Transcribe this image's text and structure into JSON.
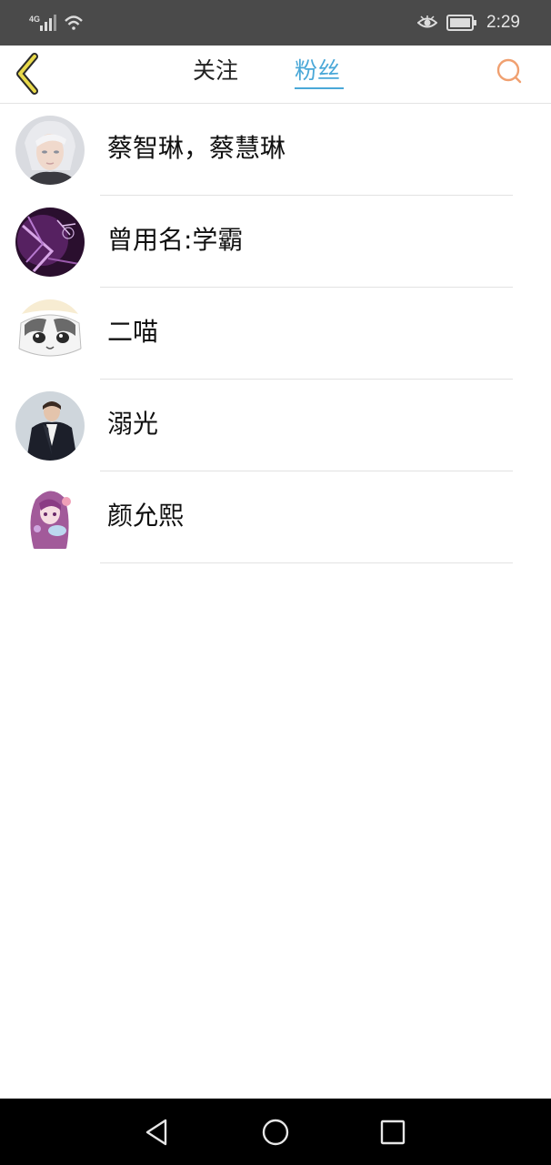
{
  "status_bar": {
    "network": "4G",
    "time": "2:29",
    "icons": [
      "signal-icon",
      "wifi-icon",
      "eye-icon",
      "battery-icon"
    ]
  },
  "header": {
    "back_icon": "back-chevron-icon",
    "tabs": [
      {
        "label": "关注",
        "active": false
      },
      {
        "label": "粉丝",
        "active": true
      }
    ],
    "search_icon": "search-icon",
    "colors": {
      "active_tab": "#4aa8d8",
      "back_icon": "#e8d94a",
      "search_icon": "#f0a070"
    }
  },
  "fans": [
    {
      "name": "蔡智琳，蔡慧琳",
      "avatar": "avatar-white-hair"
    },
    {
      "name": "曾用名:学霸",
      "avatar": "avatar-purple-abstract"
    },
    {
      "name": "二喵",
      "avatar": "avatar-cat"
    },
    {
      "name": "溺光",
      "avatar": "avatar-man-suit"
    },
    {
      "name": "颜允熙",
      "avatar": "avatar-anime-girl"
    }
  ],
  "nav_bar": {
    "buttons": [
      "back-triangle-icon",
      "home-circle-icon",
      "recents-square-icon"
    ]
  }
}
